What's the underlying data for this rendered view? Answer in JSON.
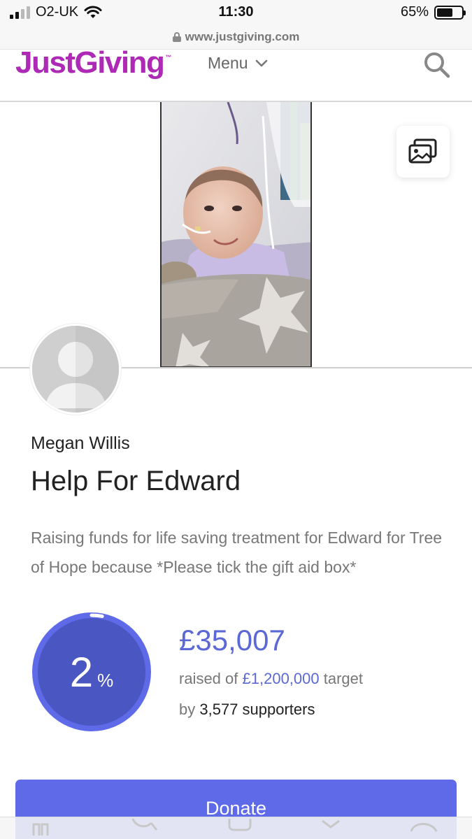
{
  "status_bar": {
    "carrier": "O2-UK",
    "time": "11:30",
    "battery_percent": "65%",
    "battery_level": 0.65
  },
  "browser": {
    "url": "www.justgiving.com"
  },
  "header": {
    "logo": "JustGiving",
    "logo_tm": "™",
    "menu_label": "Menu",
    "search_icon": "search-icon"
  },
  "hero": {
    "gallery_icon": "gallery-icon"
  },
  "page": {
    "owner_name": "Megan Willis",
    "title": "Help For Edward",
    "description": "Raising funds for life saving treatment for Edward for Tree of Hope because *Please tick the gift aid box*"
  },
  "progress": {
    "percent": "2",
    "percent_sign": "%",
    "progress_fraction": 0.03,
    "raised_amount": "£35,007",
    "raised_of": "raised of",
    "target_amount": "£1,200,000",
    "target_label": "target",
    "by_label": "by",
    "supporters": "3,577 supporters"
  },
  "actions": {
    "donate_label": "Donate"
  },
  "colors": {
    "brand": "#ad29b6",
    "accent": "#5e6ae8",
    "progress_fill": "#4a56c2"
  }
}
